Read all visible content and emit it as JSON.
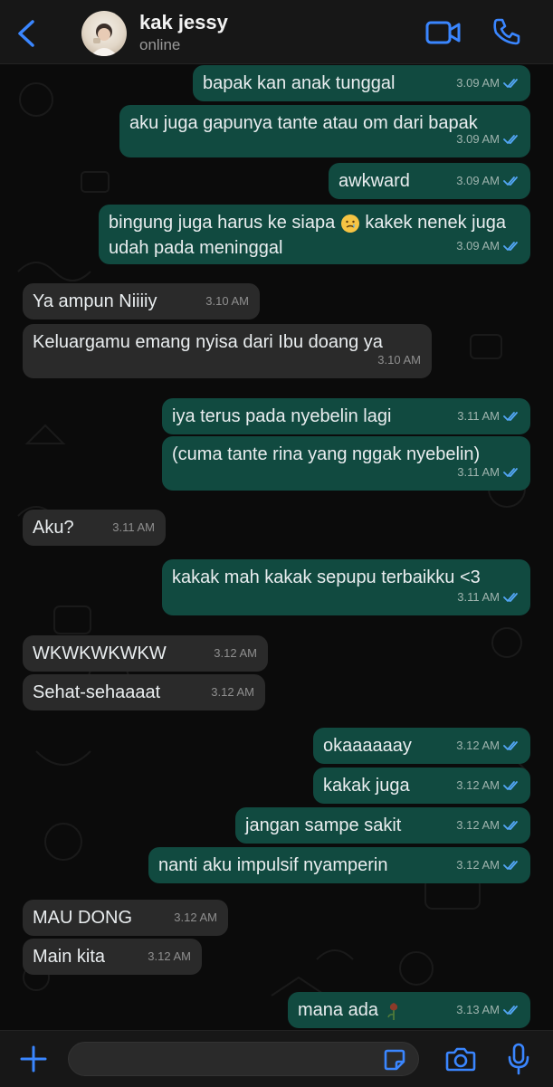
{
  "header": {
    "contact_name": "kak jessy",
    "contact_status": "online",
    "accent_color": "#3a86ff",
    "icons": [
      "chevron-left-icon",
      "video-camera-icon",
      "phone-icon"
    ]
  },
  "messages": [
    {
      "dir": "out",
      "text": "bapak kan anak tunggal",
      "time": "3.09 AM",
      "read": true
    },
    {
      "dir": "out",
      "text": "aku juga gapunya tante atau om dari bapak",
      "time": "3.09 AM",
      "read": true
    },
    {
      "dir": "out",
      "text": "awkward",
      "time": "3.09 AM",
      "read": true
    },
    {
      "dir": "out",
      "text": "bingung juga harus ke siapa",
      "emoji": "crying-face-emoji",
      "text2": "kakek nenek juga udah pada meninggal",
      "time": "3.09 AM",
      "read": true
    },
    {
      "dir": "in",
      "text": "Ya ampun Niiiiy",
      "time": "3.10 AM"
    },
    {
      "dir": "in",
      "text": "Keluargamu emang nyisa dari Ibu doang ya",
      "time": "3.10 AM"
    },
    {
      "dir": "out",
      "text": "iya terus pada nyebelin lagi",
      "time": "3.11 AM",
      "read": true
    },
    {
      "dir": "out",
      "text": "(cuma tante rina yang nggak nyebelin)",
      "time": "3.11 AM",
      "read": true
    },
    {
      "dir": "in",
      "text": "Aku?",
      "time": "3.11 AM"
    },
    {
      "dir": "out",
      "text": "kakak mah kakak sepupu terbaikku <3",
      "time": "3.11 AM",
      "read": true
    },
    {
      "dir": "in",
      "text": "WKWKWKWKW",
      "time": "3.12 AM"
    },
    {
      "dir": "in",
      "text": "Sehat-sehaaaat",
      "time": "3.12 AM"
    },
    {
      "dir": "out",
      "text": "okaaaaaay",
      "time": "3.12 AM",
      "read": true
    },
    {
      "dir": "out",
      "text": "kakak juga",
      "time": "3.12 AM",
      "read": true
    },
    {
      "dir": "out",
      "text": "jangan sampe sakit",
      "time": "3.12 AM",
      "read": true
    },
    {
      "dir": "out",
      "text": "nanti aku impulsif nyamperin",
      "time": "3.12 AM",
      "read": true
    },
    {
      "dir": "in",
      "text": "MAU DONG",
      "time": "3.12 AM"
    },
    {
      "dir": "in",
      "text": "Main kita",
      "time": "3.12 AM"
    },
    {
      "dir": "out",
      "text": "mana ada",
      "emoji": "wilted-rose-emoji",
      "time": "3.13 AM",
      "read": true
    }
  ],
  "colors": {
    "outgoing_bubble": "#114a40",
    "incoming_bubble": "#2a2a2a",
    "read_tick": "#53a6f5",
    "background": "#0b0b0b"
  },
  "input_bar": {
    "placeholder": "",
    "icons": [
      "plus-icon",
      "sticker-icon",
      "camera-icon",
      "microphone-icon"
    ]
  }
}
